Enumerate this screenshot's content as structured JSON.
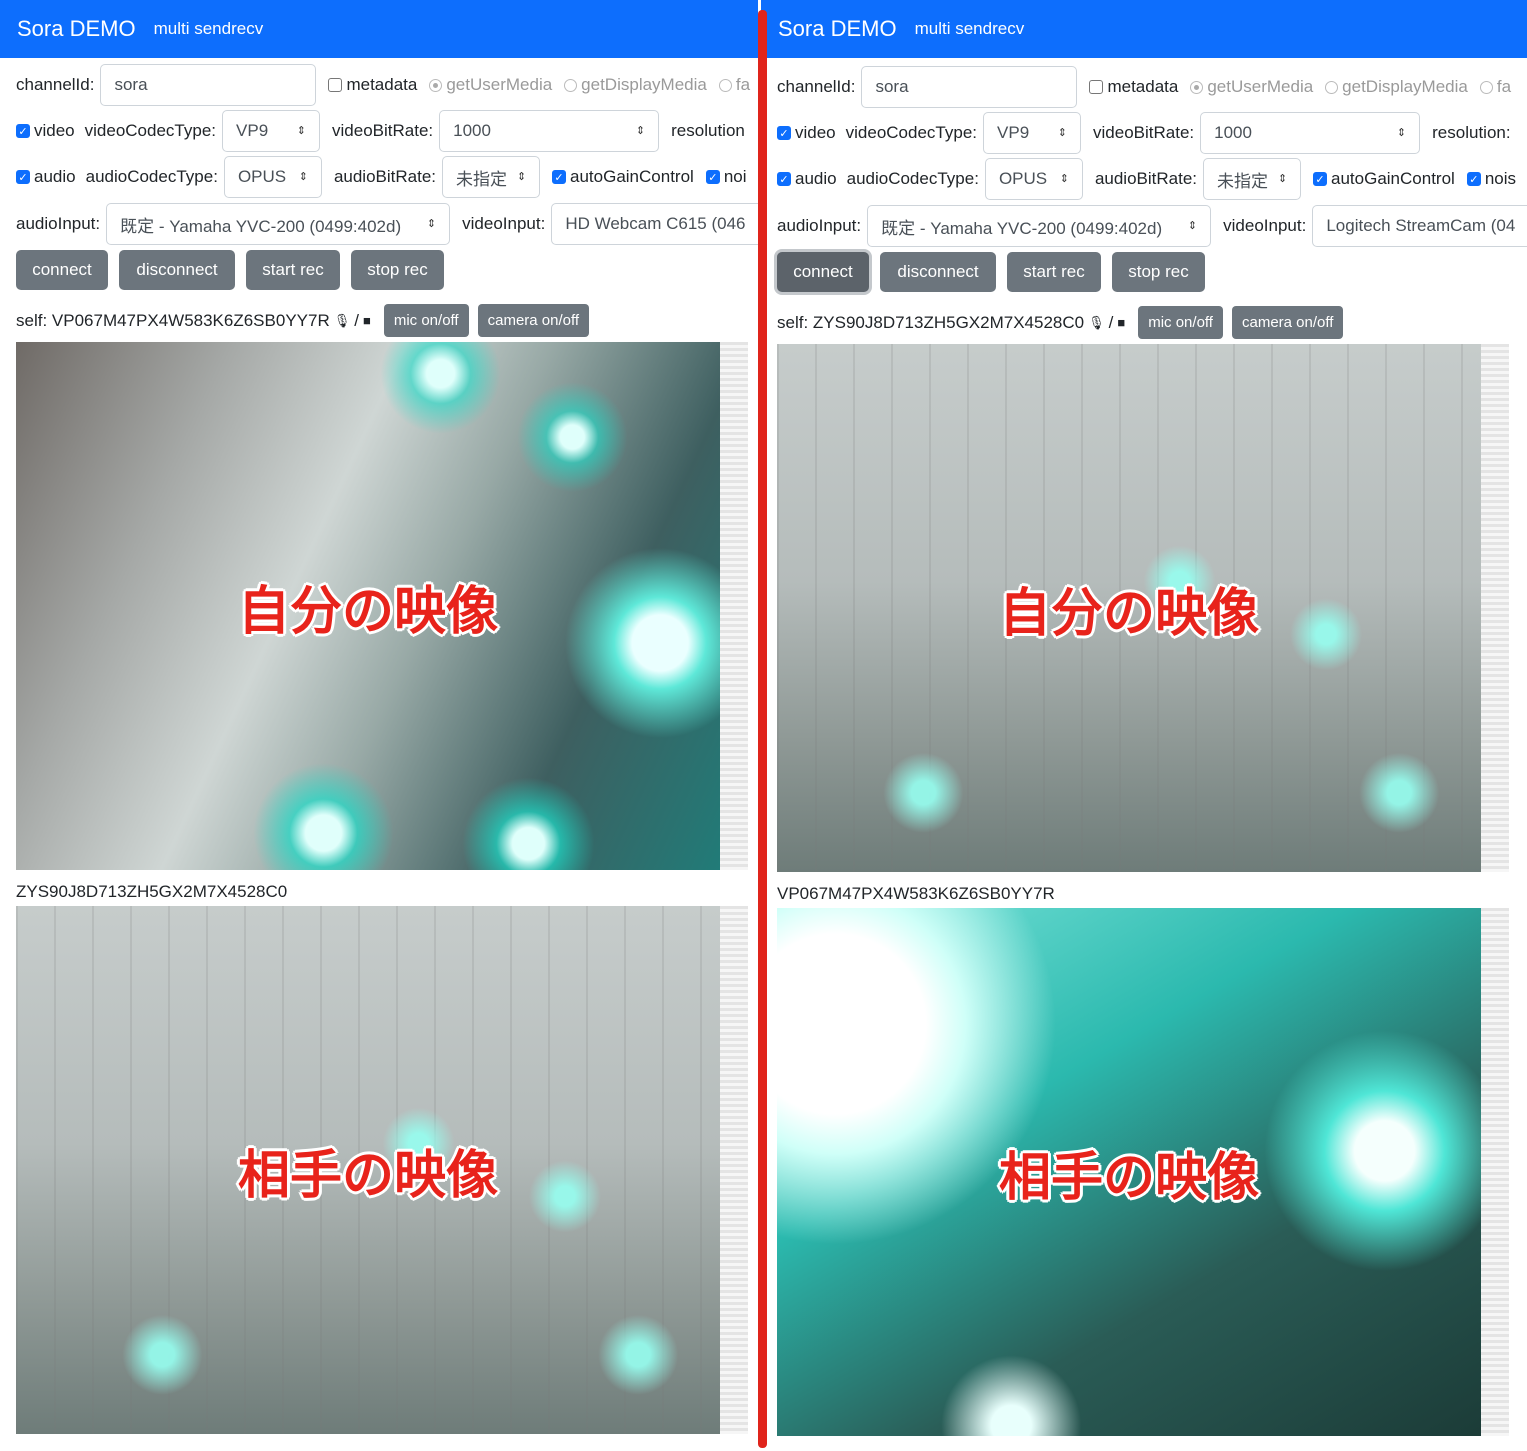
{
  "panes": [
    {
      "navbar": {
        "brand": "Sora DEMO",
        "subtitle": "multi sendrecv"
      },
      "form": {
        "channel_label": "channelId:",
        "channel_value": "sora",
        "metadata_label": "metadata",
        "media_get_user": "getUserMedia",
        "media_get_display": "getDisplayMedia",
        "media_extra": "fa",
        "video_label": "video",
        "video_codec_label": "videoCodecType:",
        "video_codec": "VP9",
        "video_bitrate_label": "videoBitRate:",
        "video_bitrate": "1000",
        "resolution_label": "resolution",
        "audio_label": "audio",
        "audio_codec_label": "audioCodecType:",
        "audio_codec": "OPUS",
        "audio_bitrate_label": "audioBitRate:",
        "audio_bitrate": "未指定",
        "agc_label": "autoGainControl",
        "noise_label": "noi",
        "audio_input_label": "audioInput:",
        "audio_input": "既定 - Yamaha YVC-200 (0499:402d)",
        "video_input_label": "videoInput:",
        "video_input": "HD Webcam C615 (046"
      },
      "buttons": {
        "connect": "connect",
        "disconnect": "disconnect",
        "start_rec": "start rec",
        "stop_rec": "stop rec"
      },
      "self": {
        "prefix": "self: VP067M47PX4W583K6Z6SB0YY7R",
        "separator": "/",
        "mic_toggle": "mic on/off",
        "camera_toggle": "camera on/off",
        "overlay": "自分の映像"
      },
      "remote": {
        "id": "ZYS90J8D713ZH5GX2M7X4528C0",
        "overlay": "相手の映像"
      }
    },
    {
      "navbar": {
        "brand": "Sora DEMO",
        "subtitle": "multi sendrecv"
      },
      "form": {
        "channel_label": "channelId:",
        "channel_value": "sora",
        "metadata_label": "metadata",
        "media_get_user": "getUserMedia",
        "media_get_display": "getDisplayMedia",
        "media_extra": "fa",
        "video_label": "video",
        "video_codec_label": "videoCodecType:",
        "video_codec": "VP9",
        "video_bitrate_label": "videoBitRate:",
        "video_bitrate": "1000",
        "resolution_label": "resolution:",
        "audio_label": "audio",
        "audio_codec_label": "audioCodecType:",
        "audio_codec": "OPUS",
        "audio_bitrate_label": "audioBitRate:",
        "audio_bitrate": "未指定",
        "agc_label": "autoGainControl",
        "noise_label": "nois",
        "audio_input_label": "audioInput:",
        "audio_input": "既定 - Yamaha YVC-200 (0499:402d)",
        "video_input_label": "videoInput:",
        "video_input": "Logitech StreamCam (04"
      },
      "buttons": {
        "connect": "connect",
        "disconnect": "disconnect",
        "start_rec": "start rec",
        "stop_rec": "stop rec"
      },
      "self": {
        "prefix": "self: ZYS90J8D713ZH5GX2M7X4528C0",
        "separator": "/",
        "mic_toggle": "mic on/off",
        "camera_toggle": "camera on/off",
        "overlay": "自分の映像"
      },
      "remote": {
        "id": "VP067M47PX4W583K6Z6SB0YY7R",
        "overlay": "相手の映像"
      }
    }
  ],
  "colors": {
    "navbar": "#0d6efd",
    "button": "#6c757d",
    "annotation": "#e8231b",
    "divider": "#e0241b"
  },
  "icons": {
    "mic": "microphone-icon",
    "camera": "video-camera-icon",
    "select": "chevron-updown-icon"
  }
}
